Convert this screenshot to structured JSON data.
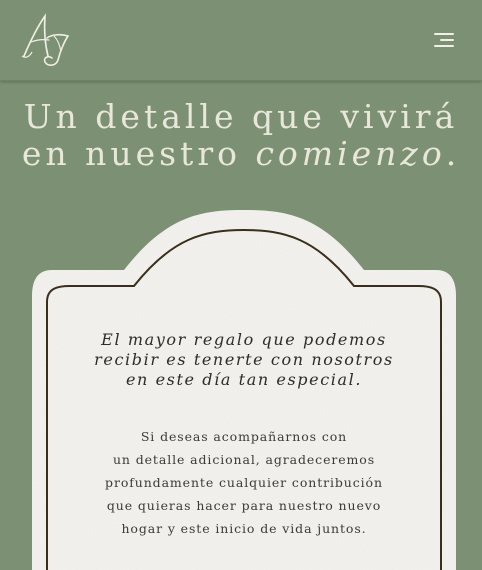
{
  "header": {
    "logo_text": "AJ",
    "menu_icon": "hamburger-menu-icon"
  },
  "hero": {
    "line1": "Un detalle que vivirá",
    "line2_plain": "en nuestro ",
    "line2_italic": "comienzo",
    "line2_end": "."
  },
  "card": {
    "quote_lines": [
      "El mayor regalo que podemos",
      "recibir es tenerte con nosotros",
      "en este día tan especial."
    ],
    "body_lines": [
      "Si deseas acompañarnos con",
      "un detalle adicional, agradeceremos",
      "profundamente cualquier contribución",
      "que quieras hacer para nuestro nuevo",
      "hogar y este inicio de vida juntos."
    ]
  },
  "colors": {
    "background": "#7c9173",
    "headline": "#e9e6da",
    "card_paper": "#f3f2ee",
    "card_frame": "#3b2f1a"
  }
}
